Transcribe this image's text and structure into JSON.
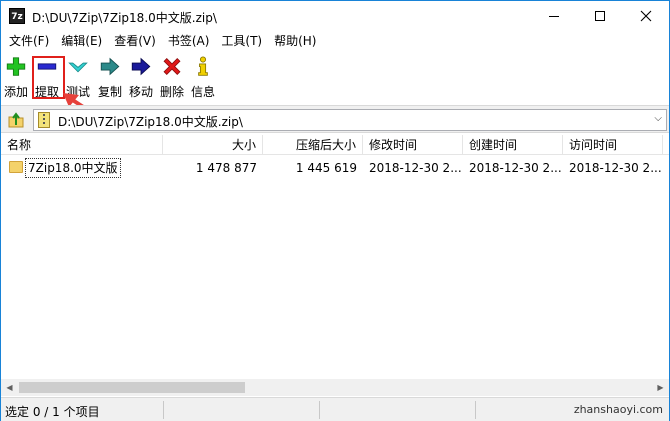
{
  "window": {
    "title": "D:\\DU\\7Zip\\7Zip18.0中文版.zip\\",
    "app_icon_text": "7z"
  },
  "menu": [
    "文件(F)",
    "编辑(E)",
    "查看(V)",
    "书签(A)",
    "工具(T)",
    "帮助(H)"
  ],
  "toolbar": {
    "add": "添加",
    "extract": "提取",
    "test": "测试",
    "copy": "复制",
    "move": "移动",
    "delete": "删除",
    "info": "信息"
  },
  "address": {
    "path": "D:\\DU\\7Zip\\7Zip18.0中文版.zip\\"
  },
  "columns": {
    "name": "名称",
    "size": "大小",
    "packed": "压缩后大小",
    "modified": "修改时间",
    "created": "创建时间",
    "accessed": "访问时间"
  },
  "rows": [
    {
      "name": "7Zip18.0中文版",
      "size": "1 478 877",
      "packed": "1 445 619",
      "modified": "2018-12-30 2...",
      "created": "2018-12-30 2...",
      "accessed": "2018-12-30 2..."
    }
  ],
  "status": {
    "selection": "选定 0 / 1 个项目"
  },
  "watermark": "zhanshaoyi.com",
  "colors": {
    "highlight": "#e0201b",
    "folder": "#f4d26a",
    "border": "#1883d7"
  }
}
